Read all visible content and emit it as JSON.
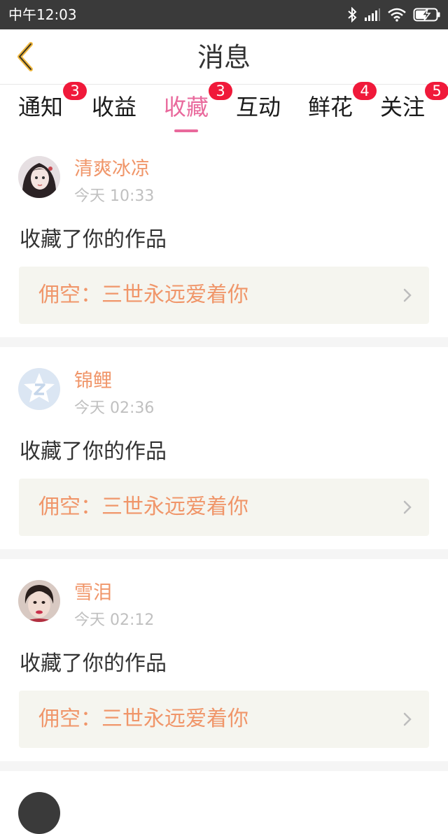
{
  "status_bar": {
    "time": "中午12:03"
  },
  "header": {
    "title": "消息"
  },
  "tabs": [
    {
      "label": "通知",
      "badge": "3"
    },
    {
      "label": "收益",
      "badge": ""
    },
    {
      "label": "收藏",
      "badge": "3"
    },
    {
      "label": "互动",
      "badge": ""
    },
    {
      "label": "鲜花",
      "badge": "4"
    },
    {
      "label": "关注",
      "badge": "5"
    }
  ],
  "active_tab": "收藏",
  "colors": {
    "accent": "#e9699c",
    "name": "#f0966a",
    "badge": "#f0193a"
  },
  "items": [
    {
      "username": "清爽冰凉",
      "time": "今天 10:33",
      "action": "收藏了你的作品",
      "work": "佣空：三世永远爱着你",
      "avatar_icon": "girl-avatar-icon"
    },
    {
      "username": "锦鲤",
      "time": "今天 02:36",
      "action": "收藏了你的作品",
      "work": "佣空：三世永远爱着你",
      "avatar_icon": "default-avatar-icon"
    },
    {
      "username": "雪泪",
      "time": "今天 02:12",
      "action": "收藏了你的作品",
      "work": "佣空：三世永远爱着你",
      "avatar_icon": "child-avatar-icon"
    }
  ]
}
